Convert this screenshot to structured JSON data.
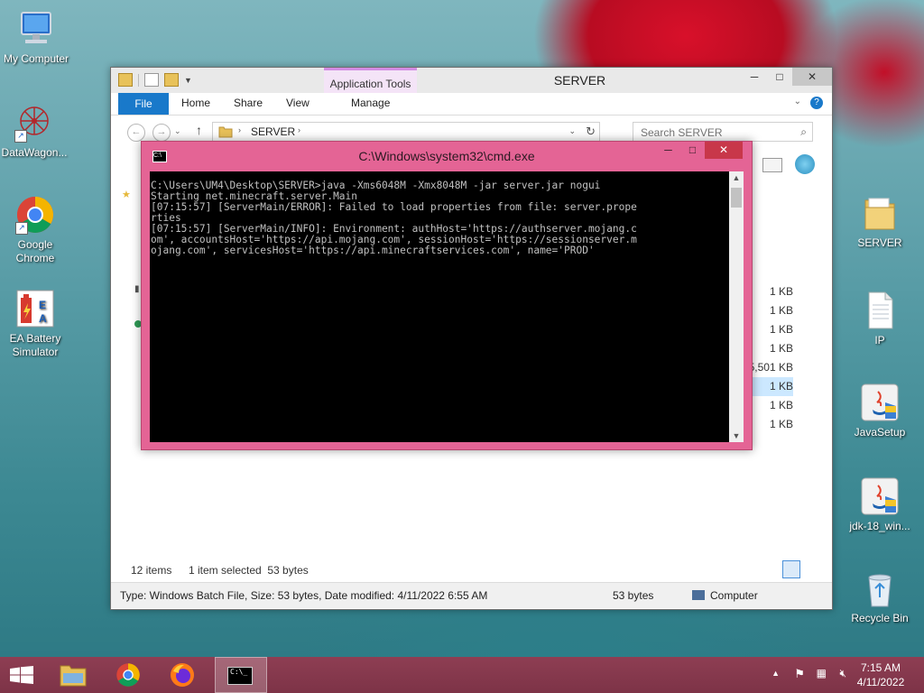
{
  "desktop": {
    "icons_left": [
      {
        "name": "my-computer",
        "label": "My Computer"
      },
      {
        "name": "datawagon",
        "label": "DataWagon..."
      },
      {
        "name": "google-chrome",
        "label": "Google Chrome"
      },
      {
        "name": "ea-battery-simulator",
        "label": "EA Battery Simulator"
      }
    ],
    "icons_right": [
      {
        "name": "server-folder",
        "label": "SERVER"
      },
      {
        "name": "ip-file",
        "label": "IP"
      },
      {
        "name": "javasetup",
        "label": "JavaSetup"
      },
      {
        "name": "jdk",
        "label": "jdk-18_win..."
      },
      {
        "name": "recycle-bin",
        "label": "Recycle Bin"
      }
    ]
  },
  "explorer": {
    "title": "SERVER",
    "contextual_tab_group": "Application Tools",
    "tabs": {
      "file": "File",
      "home": "Home",
      "share": "Share",
      "view": "View",
      "manage": "Manage"
    },
    "address_crumb": "SERVER",
    "search_placeholder": "Search SERVER",
    "file_sizes": [
      "1 KB",
      "1 KB",
      "1 KB",
      "1 KB",
      "5,501 KB",
      "1 KB",
      "1 KB",
      "1 KB"
    ],
    "selected_index": 5,
    "status": {
      "item_count": "12 items",
      "selection": "1 item selected  53 bytes",
      "details": "Type: Windows Batch File, Size: 53 bytes, Date modified: 4/11/2022 6:55 AM",
      "size": "53 bytes",
      "location": "Computer"
    }
  },
  "cmd": {
    "title": "C:\\Windows\\system32\\cmd.exe",
    "icon_text": "C:\\",
    "output": "C:\\Users\\UM4\\Desktop\\SERVER>java -Xms6048M -Xmx8048M -jar server.jar nogui\nStarting net.minecraft.server.Main\n[07:15:57] [ServerMain/ERROR]: Failed to load properties from file: server.prope\nrties\n[07:15:57] [ServerMain/INFO]: Environment: authHost='https://authserver.mojang.c\nom', accountsHost='https://api.mojang.com', sessionHost='https://sessionserver.m\nojang.com', servicesHost='https://api.minecraftservices.com', name='PROD'"
  },
  "taskbar": {
    "time": "7:15 AM",
    "date": "4/11/2022",
    "cmd_button_text": "C:\\_"
  }
}
